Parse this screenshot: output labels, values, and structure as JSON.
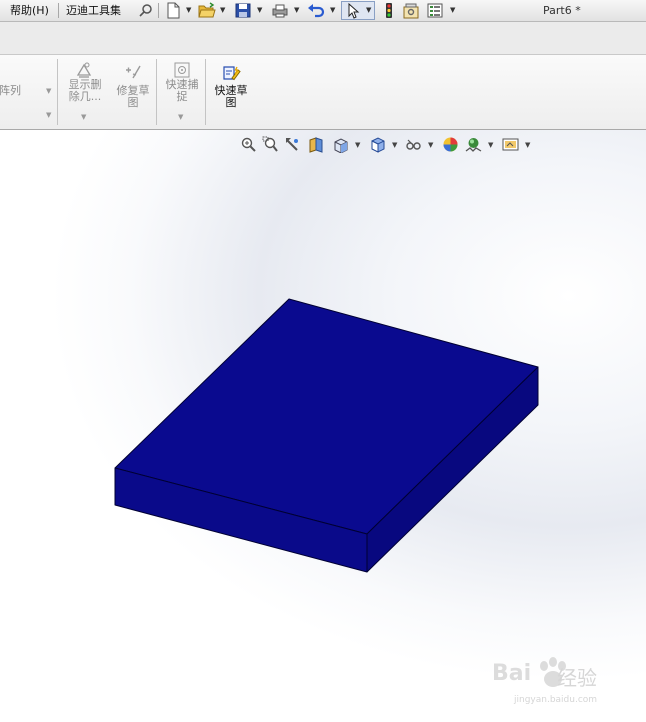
{
  "menubar": {
    "items": [
      "帮助(H)",
      "迈迪工具集"
    ],
    "document_title": "Part6 *"
  },
  "quick_access": {
    "icons": [
      "pin-icon",
      "new-document-icon",
      "open-folder-icon",
      "save-icon",
      "print-icon",
      "undo-icon",
      "select-pointer-icon",
      "traffic-light-icon",
      "options-icon",
      "properties-list-icon"
    ]
  },
  "ribbon": {
    "partial_label": "阵列",
    "show_deleted_label": "显示删\n除几...",
    "repair_sketch_label": "修复草\n图",
    "quick_snap_label": "快速捕\n捉",
    "quick_sketch_label": "快速草\n图"
  },
  "heads_up": {
    "icons": [
      "zoom-to-fit-icon",
      "zoom-area-icon",
      "previous-view-icon",
      "section-view-icon",
      "view-orientation-icon",
      "display-style-icon",
      "hide-show-icon",
      "edit-appearance-icon",
      "apply-scene-icon",
      "view-settings-icon"
    ]
  },
  "colors": {
    "model_top": "#0a0a8f",
    "model_front": "#0a0a8a",
    "model_side": "#08087f",
    "model_edge": "#000033"
  },
  "watermark": {
    "brand_text": "Bai 经验",
    "url": "jingyan.baidu.com"
  }
}
